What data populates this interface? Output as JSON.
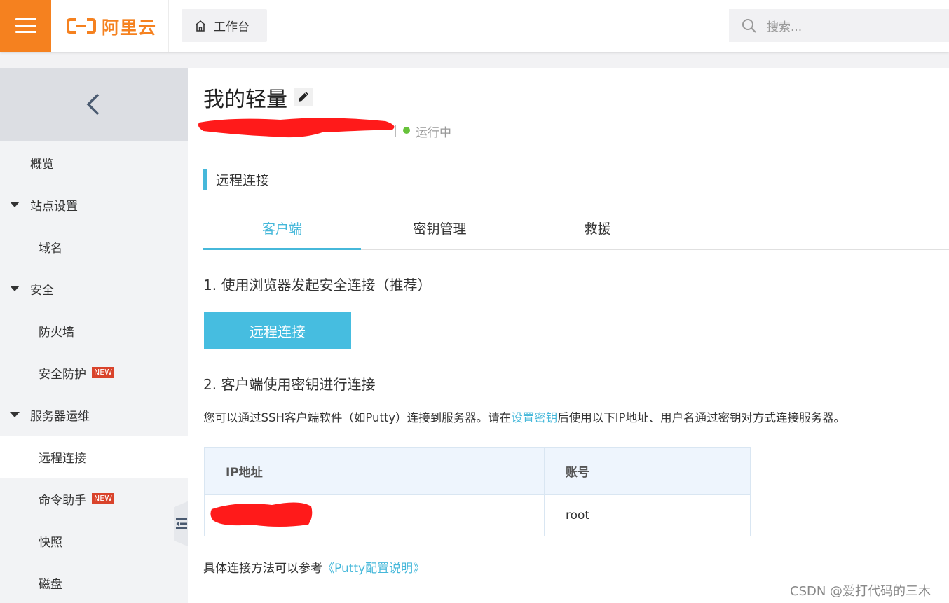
{
  "topbar": {
    "logo_text": "阿里云",
    "workbench_label": "工作台",
    "search_placeholder": "搜索..."
  },
  "sidebar": {
    "items": [
      {
        "label": "概览"
      },
      {
        "label": "站点设置"
      },
      {
        "label": "域名"
      },
      {
        "label": "安全"
      },
      {
        "label": "防火墙"
      },
      {
        "label": "安全防护",
        "badge": "NEW"
      },
      {
        "label": "服务器运维"
      },
      {
        "label": "远程连接"
      },
      {
        "label": "命令助手",
        "badge": "NEW"
      },
      {
        "label": "快照"
      },
      {
        "label": "磁盘"
      }
    ]
  },
  "main": {
    "title": "我的轻量",
    "status": "运行中",
    "section_title": "远程连接",
    "tabs": [
      {
        "label": "客户端"
      },
      {
        "label": "密钥管理"
      },
      {
        "label": "救援"
      }
    ],
    "step1": "1. 使用浏览器发起安全连接（推荐）",
    "connect_button": "远程连接",
    "step2": "2. 客户端使用密钥进行连接",
    "desc_prefix": "您可以通过SSH客户端软件（如Putty）连接到服务器。请在",
    "desc_link": "设置密钥",
    "desc_suffix": "后使用以下IP地址、用户名通过密钥对方式连接服务器。",
    "table": {
      "headers": [
        "IP地址",
        "账号"
      ],
      "rows": [
        [
          "",
          "root"
        ]
      ]
    },
    "ref_prefix": "具体连接方法可以参考",
    "ref_link": "《Putty配置说明》"
  },
  "watermark": "CSDN @爱打代码的三木",
  "colors": {
    "brand_orange": "#f5811f",
    "accent_blue": "#46b8da",
    "status_green": "#67c23a",
    "badge_red": "#d9432b"
  }
}
